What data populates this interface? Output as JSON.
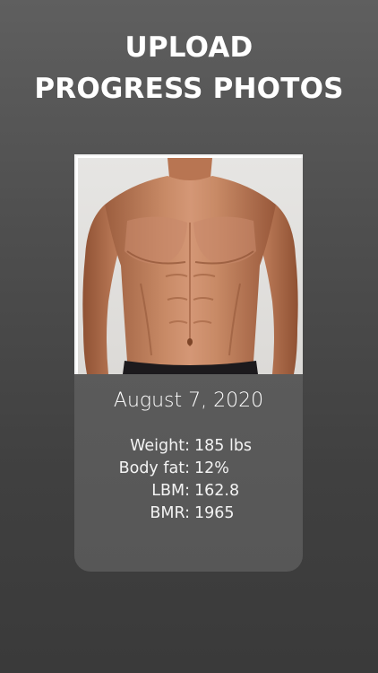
{
  "header": {
    "line1": "UPLOAD",
    "line2": "PROGRESS PHOTOS"
  },
  "card": {
    "photo_description": "progress-photo",
    "date": "August 7, 2020",
    "stats": [
      {
        "label": "Weight:",
        "value": "185 lbs"
      },
      {
        "label": "Body fat:",
        "value": "12%"
      },
      {
        "label": "LBM:",
        "value": "162.8"
      },
      {
        "label": "BMR:",
        "value": "1965"
      }
    ]
  },
  "colors": {
    "background_top": "#5f5f5f",
    "background_bottom": "#3a3a3a",
    "card_background": "#5d5d5d",
    "text": "#ffffff"
  }
}
